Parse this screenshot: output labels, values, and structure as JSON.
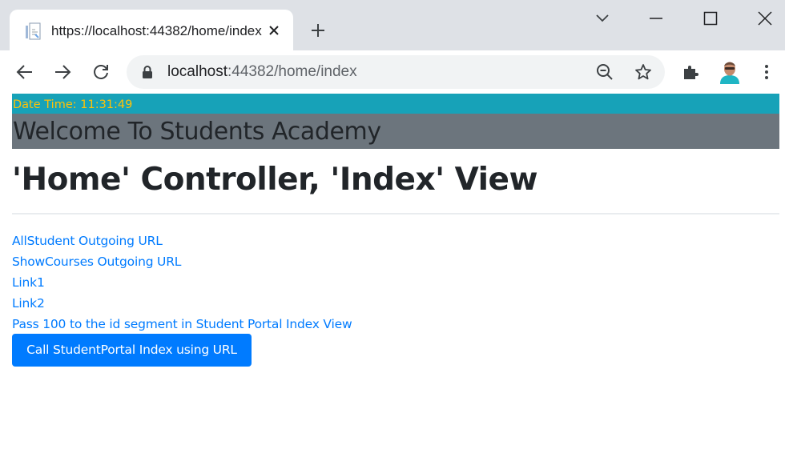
{
  "browser": {
    "tab_title": "https://localhost:44382/home/index",
    "url_host": "localhost",
    "url_path": ":44382/home/index"
  },
  "page": {
    "datetime": "Date Time: 11:31:49",
    "welcome": "Welcome To Students Academy",
    "heading": "'Home' Controller, 'Index' View",
    "links": [
      "AllStudent Outgoing URL",
      "ShowCourses Outgoing URL",
      "Link1",
      "Link2",
      "Pass 100 to the id segment in Student Portal Index View"
    ],
    "button_label": "Call StudentPortal Index using URL"
  },
  "colors": {
    "tabbar": "#dee1e6",
    "info": "#17a2b8",
    "warning": "#ffc107",
    "secondary": "#6c757d",
    "primary": "#007bff"
  }
}
